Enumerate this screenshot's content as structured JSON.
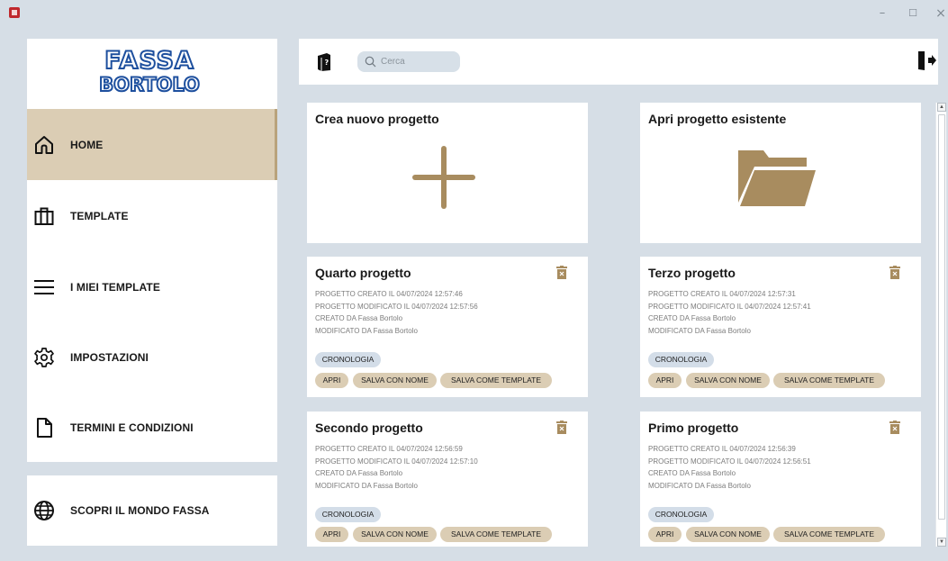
{
  "window": {
    "minimize_glyph": "–",
    "maximize_glyph": "☐",
    "close_glyph": "×"
  },
  "logo": {
    "line1": "FASSA",
    "line2": "BORTOLO"
  },
  "sidebar": {
    "items": [
      {
        "label": "HOME",
        "icon": "home-icon",
        "active": true
      },
      {
        "label": "TEMPLATE",
        "icon": "briefcase-icon",
        "active": false
      },
      {
        "label": "I MIEI TEMPLATE",
        "icon": "menu-lines-icon",
        "active": false
      },
      {
        "label": "IMPOSTAZIONI",
        "icon": "gear-icon",
        "active": false
      },
      {
        "label": "TERMINI E CONDIZIONI",
        "icon": "document-icon",
        "active": false
      }
    ],
    "bottom_item": {
      "label": "SCOPRI IL MONDO FASSA",
      "icon": "globe-icon"
    }
  },
  "header": {
    "search_placeholder": "Cerca"
  },
  "actions": {
    "new_project": "Crea nuovo progetto",
    "open_project": "Apri progetto esistente"
  },
  "projects": [
    {
      "title": "Quarto progetto",
      "created": "PROGETTO CREATO IL 04/07/2024 12:57:46",
      "modified": "PROGETTO MODIFICATO IL 04/07/2024 12:57:56",
      "created_by": "CREATO DA Fassa Bortolo",
      "modified_by": "MODIFICATO DA Fassa Bortolo"
    },
    {
      "title": "Terzo progetto",
      "created": "PROGETTO CREATO IL 04/07/2024 12:57:31",
      "modified": "PROGETTO MODIFICATO IL 04/07/2024 12:57:41",
      "created_by": "CREATO DA Fassa Bortolo",
      "modified_by": "MODIFICATO DA Fassa Bortolo"
    },
    {
      "title": "Secondo progetto",
      "created": "PROGETTO CREATO IL 04/07/2024 12:56:59",
      "modified": "PROGETTO MODIFICATO IL 04/07/2024 12:57:10",
      "created_by": "CREATO DA Fassa Bortolo",
      "modified_by": "MODIFICATO DA Fassa Bortolo"
    },
    {
      "title": "Primo progetto",
      "created": "PROGETTO CREATO IL 04/07/2024 12:56:39",
      "modified": "PROGETTO MODIFICATO IL 04/07/2024 12:56:51",
      "created_by": "CREATO DA Fassa Bortolo",
      "modified_by": "MODIFICATO DA Fassa Bortolo"
    }
  ],
  "buttons": {
    "history": "CRONOLOGIA",
    "open": "APRI",
    "save_as": "SALVA CON NOME",
    "save_as_template": "SALVA COME TEMPLATE"
  },
  "colors": {
    "accent_tan": "#dbcdb4",
    "icon_brown": "#a88c5f",
    "pill_blue": "#d3dde8",
    "brand_blue": "#1d4f9e",
    "background": "#d6dee6"
  }
}
